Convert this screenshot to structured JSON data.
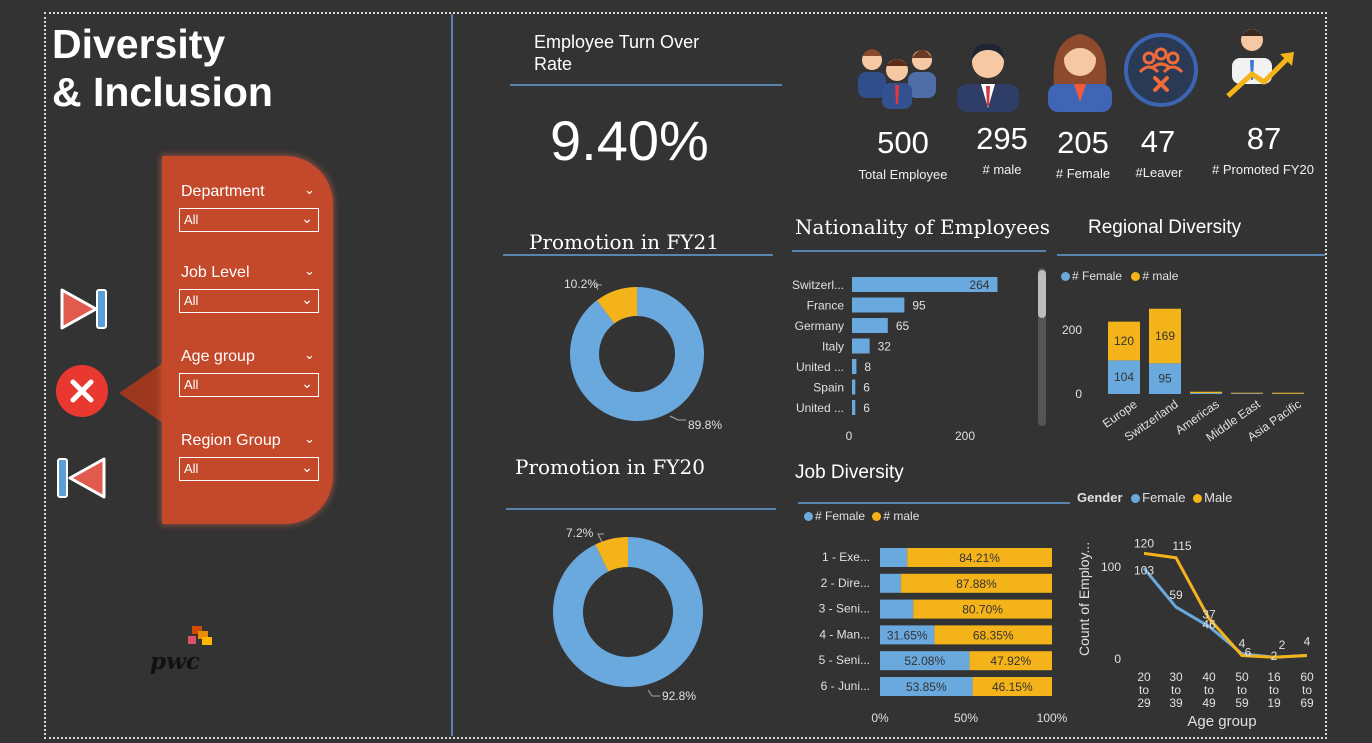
{
  "title_line1": "Diversity",
  "title_line2": "& Inclusion",
  "filters": [
    {
      "label": "Department",
      "value": "All"
    },
    {
      "label": "Job Level",
      "value": "All"
    },
    {
      "label": "Age group",
      "value": "All"
    },
    {
      "label": "Region Group",
      "value": "All"
    }
  ],
  "logo_text": "pwc",
  "turnover": {
    "title_line1": "Employee Turn Over",
    "title_line2": "Rate",
    "value": "9.40%"
  },
  "kpis": [
    {
      "value": "500",
      "label": "Total Employee",
      "icon": "group-people-icon"
    },
    {
      "value": "295",
      "label": "# male",
      "icon": "male-person-icon"
    },
    {
      "value": "205",
      "label": "# Female",
      "icon": "female-person-icon"
    },
    {
      "value": "47",
      "label": "#Leaver",
      "icon": "leaver-group-icon"
    },
    {
      "value": "87",
      "label": "# Promoted FY20",
      "icon": "promotion-arrow-icon"
    }
  ],
  "colors": {
    "female": "#6aa9de",
    "male": "#f5b31a",
    "accent": "#c4492a",
    "line": "#5a84b0"
  },
  "chart_data": [
    {
      "type": "pie",
      "title": "Promotion in FY21",
      "slices": [
        {
          "value": 89.8,
          "label": "89.8%"
        },
        {
          "value": 10.2,
          "label": "10.2%"
        }
      ]
    },
    {
      "type": "pie",
      "title": "Promotion in FY20",
      "slices": [
        {
          "value": 92.8,
          "label": "92.8%"
        },
        {
          "value": 7.2,
          "label": "7.2%"
        }
      ]
    },
    {
      "type": "bar",
      "title": "Nationality of Employees",
      "categories": [
        "Switzerl...",
        "France",
        "Germany",
        "Italy",
        "United ...",
        "Spain",
        "United ..."
      ],
      "values": [
        264,
        95,
        65,
        32,
        8,
        6,
        6
      ],
      "xticks": [
        "0",
        "200"
      ],
      "xlim": [
        0,
        340
      ]
    },
    {
      "type": "bar",
      "title": "Regional Diversity",
      "categories": [
        "Europe",
        "Switzerland",
        "Americas",
        "Middle East",
        "Asia Pacific"
      ],
      "series": [
        {
          "name": "# Female",
          "values": [
            104,
            95,
            3,
            2,
            1
          ]
        },
        {
          "name": "# male",
          "values": [
            120,
            169,
            4,
            2,
            3
          ]
        }
      ],
      "ylim": [
        0,
        280
      ],
      "yticks": [
        "200",
        "0"
      ]
    },
    {
      "type": "bar",
      "title": "Job Diversity",
      "categories": [
        "1 - Exe...",
        "2 - Dire...",
        "3 - Seni...",
        "4 - Man...",
        "5 - Seni...",
        "6 - Juni..."
      ],
      "series": [
        {
          "name": "# Female",
          "values": [
            15.79,
            12.12,
            19.3,
            31.65,
            52.08,
            53.85
          ]
        },
        {
          "name": "# male",
          "values": [
            84.21,
            87.88,
            80.7,
            68.35,
            47.92,
            46.15
          ]
        }
      ],
      "data_labels_female": [
        "",
        "",
        "",
        "31.65%",
        "52.08%",
        "53.85%"
      ],
      "data_labels_male": [
        "84.21%",
        "87.88%",
        "80.70%",
        "68.35%",
        "47.92%",
        "46.15%"
      ],
      "xticks": [
        "0%",
        "50%",
        "100%"
      ]
    },
    {
      "type": "line",
      "legend_title": "Gender",
      "categories": [
        "20 to 29",
        "30 to 39",
        "40 to 49",
        "50 to 59",
        "16 to 19",
        "60 to 69"
      ],
      "series": [
        {
          "name": "Female",
          "values": [
            103,
            59,
            37,
            6,
            2,
            4
          ]
        },
        {
          "name": "Male",
          "values": [
            120,
            115,
            46,
            4,
            2,
            4
          ]
        }
      ],
      "ylabel": "Count of Employ...",
      "xlabel": "Age group",
      "yticks": [
        "100",
        "0"
      ],
      "ylim": [
        0,
        135
      ]
    }
  ]
}
